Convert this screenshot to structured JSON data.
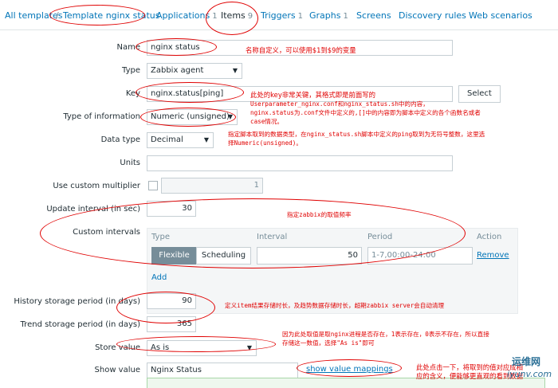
{
  "tabs": {
    "breadcrumb_all": "All templates",
    "breadcrumb_sep": "/",
    "breadcrumb_template": "Template nginx status",
    "applications": "Applications",
    "applications_count": "1",
    "items": "Items",
    "items_count": "9",
    "triggers": "Triggers",
    "triggers_count": "1",
    "graphs": "Graphs",
    "graphs_count": "1",
    "screens": "Screens",
    "discovery_rules": "Discovery rules",
    "web_scenarios": "Web scenarios"
  },
  "form": {
    "name_label": "Name",
    "name_value": "nginx status",
    "type_label": "Type",
    "type_value": "Zabbix agent",
    "key_label": "Key",
    "key_value": "nginx.status[ping]",
    "select_button": "Select",
    "type_of_info_label": "Type of information",
    "type_of_info_value": "Numeric (unsigned)",
    "data_type_label": "Data type",
    "data_type_value": "Decimal",
    "units_label": "Units",
    "units_value": "",
    "custom_multiplier_label": "Use custom multiplier",
    "custom_multiplier_value": "1",
    "update_interval_label": "Update interval (in sec)",
    "update_interval_value": "30",
    "custom_intervals_label": "Custom intervals",
    "ci_type_header": "Type",
    "ci_interval_header": "Interval",
    "ci_period_header": "Period",
    "ci_action_header": "Action",
    "ci_flexible": "Flexible",
    "ci_scheduling": "Scheduling",
    "ci_interval_value": "50",
    "ci_period_value": "1-7,00:00-24:00",
    "ci_remove": "Remove",
    "ci_add": "Add",
    "history_label": "History storage period (in days)",
    "history_value": "90",
    "trend_label": "Trend storage period (in days)",
    "trend_value": "365",
    "store_value_label": "Store value",
    "store_value_value": "As is",
    "show_value_label": "Show value",
    "show_value_value": "Nginx Status",
    "show_value_mappings": "show value mappings"
  },
  "annotations": {
    "name_note": "名称自定义，可以使用$1到$9的变量",
    "key_note_1": "此处的key非常关键，其格式即是前面写的",
    "key_note_2": "Userparameter_nginx.conf和nginx_status.sh中的内容，",
    "key_note_3": "nginx.status为.conf文件中定义的,[]中的内容即为脚本中定义的各个函数名或者",
    "key_note_4": "case情况。",
    "type_note_1": "指定脚本取到的数据类型，在nginx_status.sh脚本中定义的ping取到为无符号整数，这里选",
    "type_note_2": "择Numeric(unsigned)。",
    "interval_note": "指定zabbix的取值频率",
    "history_note": "定义item结果存储时长，及趋势数据存储时长，超期zabbix server会自动清理",
    "store_note_1": "因为此处取值是取nginx进程是否存在，1表示存在，0表示不存在，所以直接",
    "store_note_2": "存储这一数值，选择\"As is\"即可",
    "show_note_1": "此处点击一下，将取到的值对应成相",
    "show_note_2": "应的含义，便能够更直观的看到数据"
  },
  "watermark": {
    "brand": "运维网",
    "sub": "iyunv.com"
  },
  "colors": {
    "link": "#0275b8",
    "annotation": "#e00000",
    "segment_active": "#768d99"
  }
}
